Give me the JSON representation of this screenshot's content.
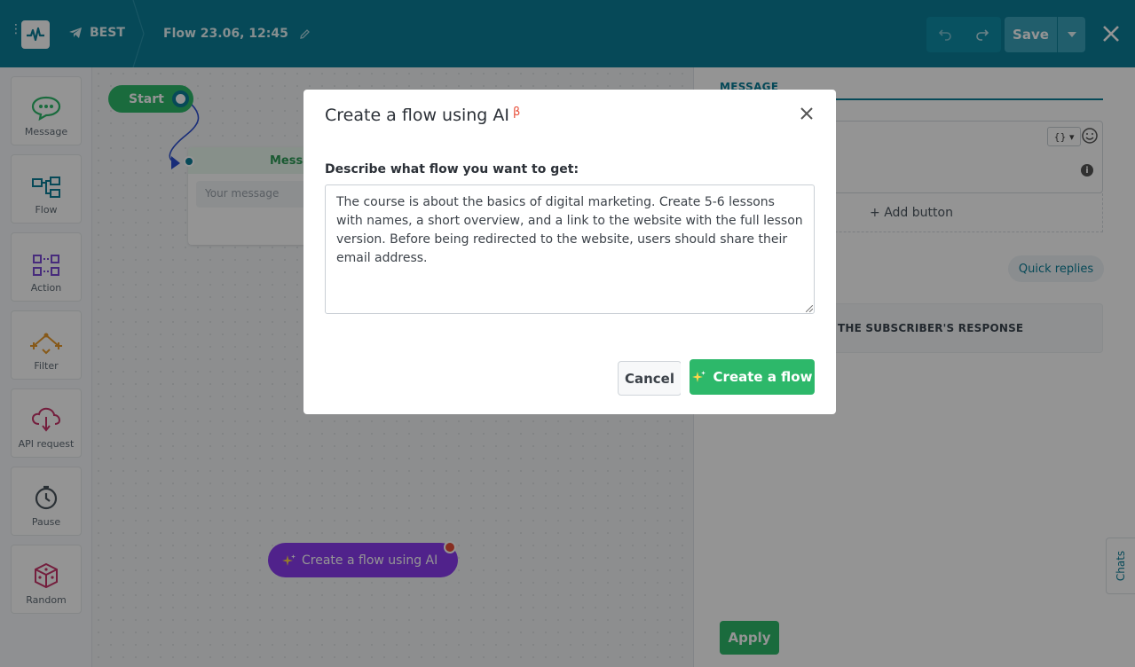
{
  "header": {
    "bot_name": "BEST",
    "flow_title": "Flow 23.06, 12:45",
    "save_label": "Save",
    "icons": [
      "logo-icon",
      "telegram-icon",
      "edit-pencil-icon",
      "undo-icon",
      "redo-icon",
      "caret-down-icon",
      "close-icon"
    ]
  },
  "toolbar": {
    "items": [
      {
        "label": "Message",
        "icon": "message-bubble-icon",
        "color": "#2db86a"
      },
      {
        "label": "Flow",
        "icon": "flow-icon",
        "color": "#0b7e98"
      },
      {
        "label": "Action",
        "icon": "action-icon",
        "color": "#7b4ad6"
      },
      {
        "label": "Filter",
        "icon": "filter-icon",
        "color": "#e89a2b"
      },
      {
        "label": "API request",
        "icon": "api-cloud-icon",
        "color": "#c8346a"
      },
      {
        "label": "Pause",
        "icon": "clock-icon",
        "color": "#49535c"
      },
      {
        "label": "Random",
        "icon": "dice-icon",
        "color": "#c8346a"
      }
    ]
  },
  "canvas": {
    "start_label": "Start",
    "message_node_title": "Messa",
    "message_placeholder": "Your message",
    "ai_button_label": "Create a flow using AI"
  },
  "right_panel": {
    "tab_label": "MESSAGE",
    "var_button": "{}",
    "add_button": "+ Add button",
    "quick_replies": "Quick replies",
    "subscriber_response": "THE SUBSCRIBER'S RESPONSE",
    "apply_label": "Apply",
    "chats_tab": "Chats"
  },
  "modal": {
    "title": "Create a flow using AI",
    "beta": "β",
    "description_label": "Describe what flow you want to get:",
    "description_value": "The course is about the basics of digital marketing. Create 5-6 lessons with names, a short overview, and a link to the website with the full lesson version. Before being redirected to the website, users should share their email address.",
    "cancel_label": "Cancel",
    "create_label": "Create a flow"
  },
  "colors": {
    "header_bg": "#0b7e98",
    "accent_green": "#2db86a",
    "ai_purple": "#8a3cf0",
    "beta_red": "#e8503a"
  }
}
